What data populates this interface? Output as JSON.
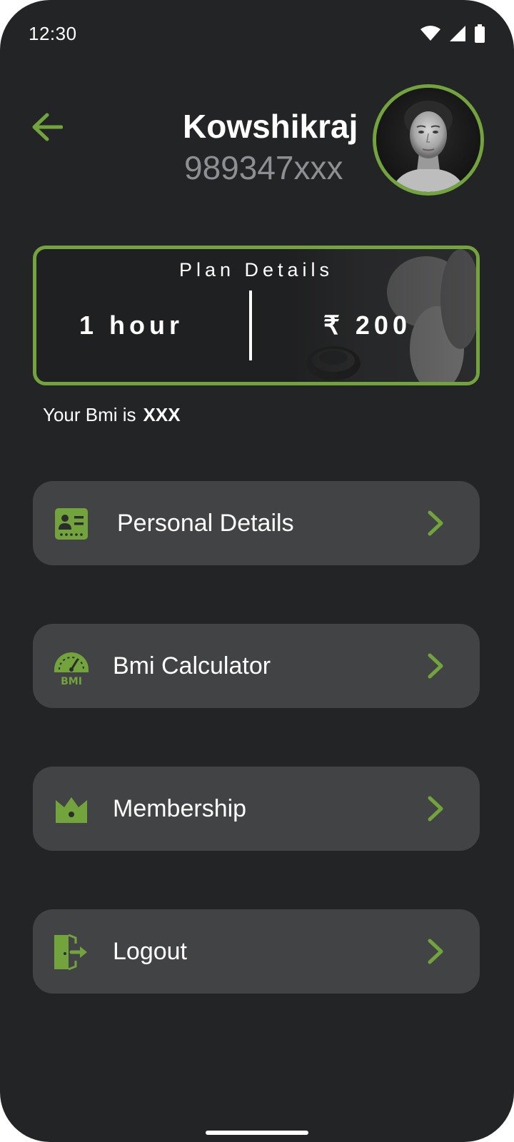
{
  "status_bar": {
    "time": "12:30"
  },
  "header": {
    "name": "Kowshikraj",
    "phone": "989347xxx"
  },
  "plan": {
    "title": "Plan Details",
    "duration": "1 hour",
    "price": "₹ 200"
  },
  "bmi": {
    "label": "Your Bmi is",
    "value": "XXX"
  },
  "menu": {
    "items": [
      {
        "label": "Personal Details",
        "icon": "id-card-icon"
      },
      {
        "label": "Bmi Calculator",
        "icon": "bmi-gauge-icon"
      },
      {
        "label": "Membership",
        "icon": "crown-icon"
      },
      {
        "label": "Logout",
        "icon": "logout-icon"
      }
    ]
  },
  "colors": {
    "accent": "#73a33c",
    "background": "#232426",
    "card": "#424345"
  }
}
